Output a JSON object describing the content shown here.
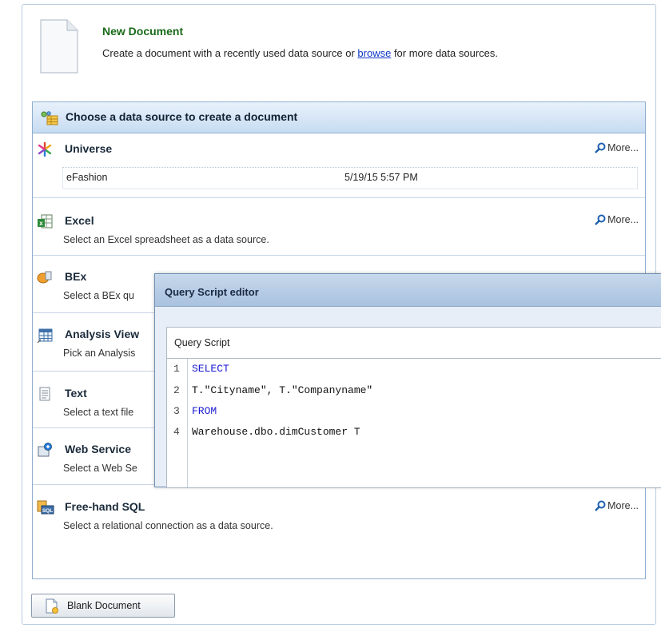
{
  "new_document": {
    "title": "New Document",
    "desc_before": "Create a document with a recently used data source or ",
    "browse_link": "browse",
    "desc_after": " for more data sources."
  },
  "panel": {
    "title": "Choose a data source to create a document"
  },
  "sources": [
    {
      "name": "Universe",
      "more": "More...",
      "icon": "universe-icon"
    },
    {
      "name": "Excel",
      "desc": "Select an Excel spreadsheet as a data source.",
      "more": "More...",
      "icon": "excel-icon"
    },
    {
      "name": "BEx",
      "desc": "Select a BEx qu",
      "icon": "bex-icon"
    },
    {
      "name": "Analysis View",
      "desc": "Pick an Analysis",
      "icon": "analysis-view-icon"
    },
    {
      "name": "Text",
      "desc": "Select a text file",
      "icon": "text-file-icon"
    },
    {
      "name": "Web Service",
      "desc": "Select a Web Se",
      "icon": "web-service-icon"
    },
    {
      "name": "Free-hand SQL",
      "desc": "Select a relational connection as a data source.",
      "more": "More...",
      "icon": "sql-icon"
    }
  ],
  "recent_universe": {
    "name": "eFashion",
    "date": "5/19/15 5:57 PM"
  },
  "blank_button": {
    "label": "Blank Document"
  },
  "dialog": {
    "title": "Query Script editor",
    "section_label": "Query Script",
    "lines": [
      {
        "num": "1",
        "text": "SELECT",
        "keyword": true
      },
      {
        "num": "2",
        "text": "T.\"Cityname\", T.\"Companyname\"",
        "keyword": false
      },
      {
        "num": "3",
        "text": "FROM",
        "keyword": true
      },
      {
        "num": "4",
        "text": "Warehouse.dbo.dimCustomer T",
        "keyword": false
      }
    ]
  },
  "colors": {
    "title_green": "#1a6a1a",
    "link_blue": "#1038c8",
    "keyword_blue": "#1a1ad0",
    "panel_border": "#8faecf"
  }
}
